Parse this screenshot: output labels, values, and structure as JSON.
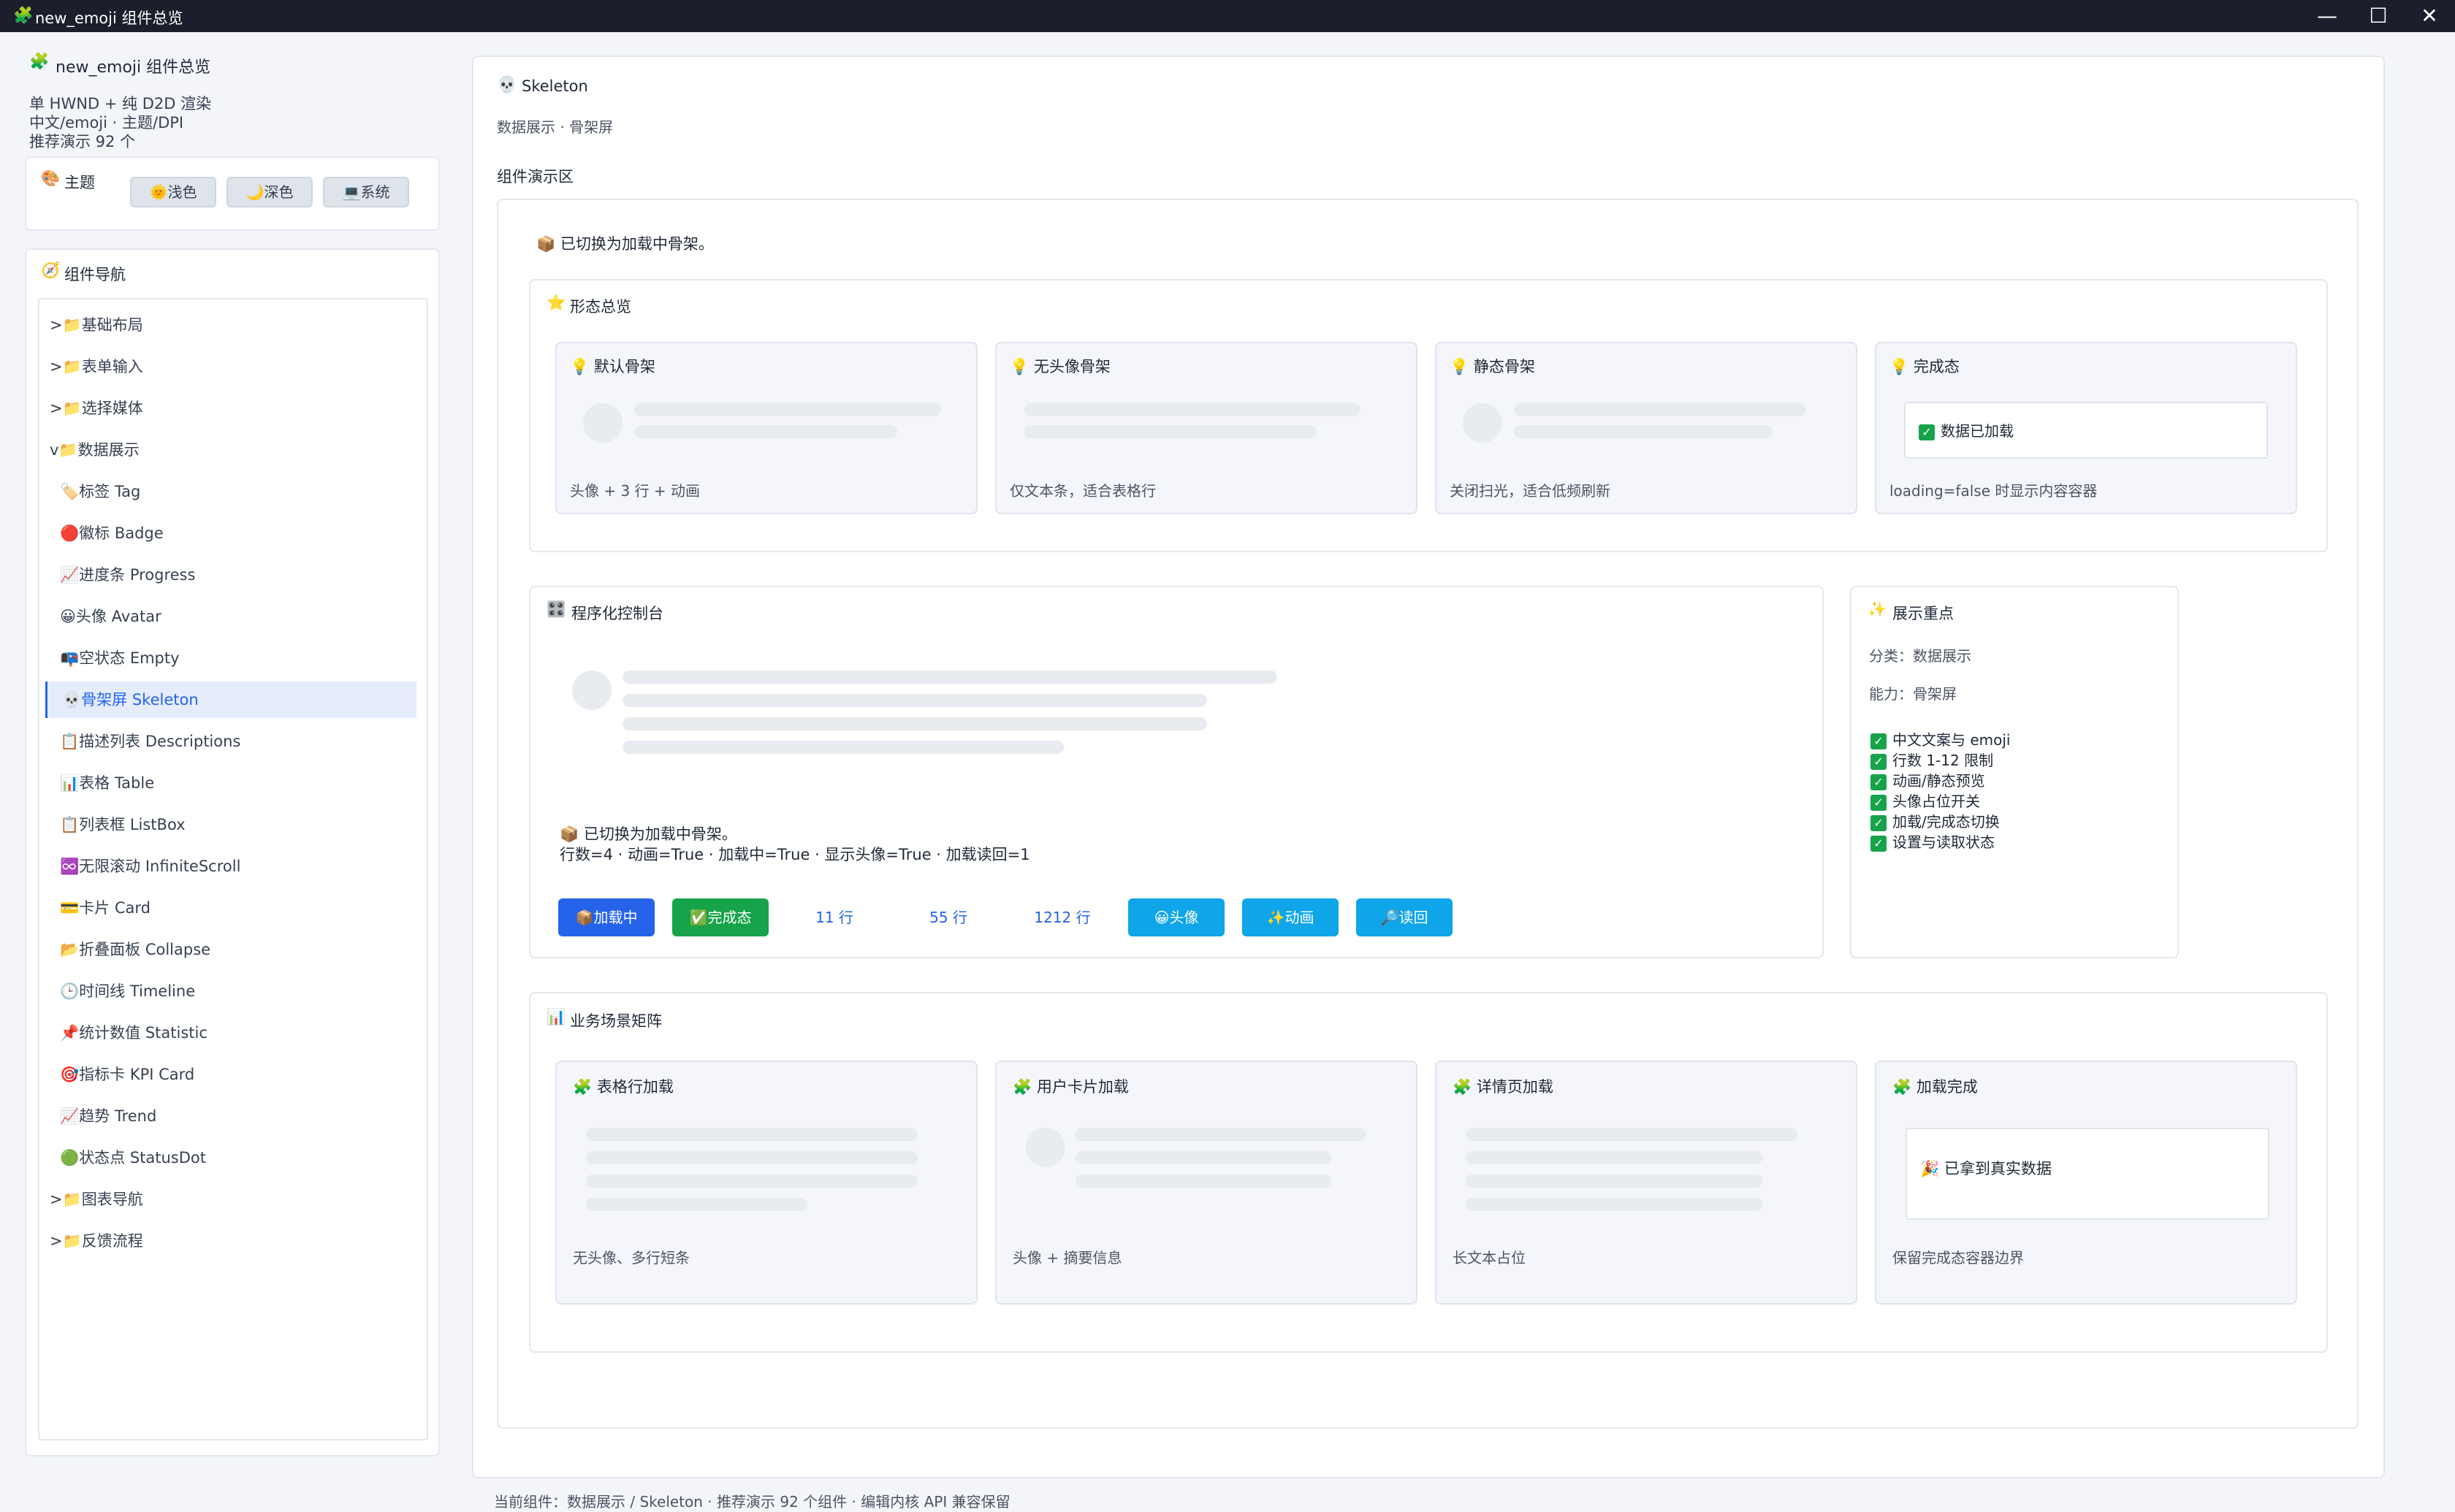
{
  "window": {
    "title": "new_emoji 组件总览",
    "icon": "🧩"
  },
  "sidebar": {
    "app_title": "new_emoji 组件总览",
    "app_icon": "🧩",
    "info_line1": "单 HWND + 纯 D2D 渲染",
    "info_line2": "中文/emoji · 主题/DPI",
    "info_line3": "推荐演示 92 个",
    "theme": {
      "label": "主题",
      "icon": "🎨",
      "buttons": [
        "🌞浅色",
        "🌙深色",
        "💻系统"
      ]
    },
    "nav": {
      "label": "组件导航",
      "icon": "🧭",
      "items": [
        {
          "label": ">📁基础布局"
        },
        {
          "label": ">📁表单输入"
        },
        {
          "label": ">📁选择媒体"
        },
        {
          "label": "v📁数据展示"
        },
        {
          "label": "🏷️标签 Tag"
        },
        {
          "label": "🔴徽标 Badge"
        },
        {
          "label": "📈进度条 Progress"
        },
        {
          "label": "😀头像 Avatar"
        },
        {
          "label": "📭空状态 Empty"
        },
        {
          "label": "💀骨架屏 Skeleton"
        },
        {
          "label": "📋描述列表 Descriptions"
        },
        {
          "label": "📊表格 Table"
        },
        {
          "label": "📋列表框 ListBox"
        },
        {
          "label": "♾️无限滚动 InfiniteScroll"
        },
        {
          "label": "💳卡片 Card"
        },
        {
          "label": "📂折叠面板 Collapse"
        },
        {
          "label": "🕒时间线 Timeline"
        },
        {
          "label": "📌统计数值 Statistic"
        },
        {
          "label": "🎯指标卡 KPI Card"
        },
        {
          "label": "📈趋势 Trend"
        },
        {
          "label": "🟢状态点 StatusDot"
        },
        {
          "label": ">📁图表导航"
        },
        {
          "label": ">📁反馈流程"
        }
      ]
    }
  },
  "main": {
    "title": "Skeleton",
    "title_icon": "💀",
    "breadcrumb": "数据展示 · 骨架屏",
    "demo_label": "组件演示区",
    "status_msg": "📦 已切换为加载中骨架。",
    "overview": {
      "title": "形态总览",
      "icon": "⭐",
      "cards": [
        {
          "title": "💡 默认骨架",
          "caption": "头像 + 3 行 + 动画"
        },
        {
          "title": "💡 无头像骨架",
          "caption": "仅文本条，适合表格行"
        },
        {
          "title": "💡 静态骨架",
          "caption": "关闭扫光，适合低频刷新"
        },
        {
          "title": "💡 完成态",
          "caption": "loading=false 时显示内容容器",
          "content": "数据已加载"
        }
      ]
    },
    "console": {
      "title": "程序化控制台",
      "icon": "🎛️",
      "status_line1": "📦 已切换为加载中骨架。",
      "status_line2": "行数=4 · 动画=True · 加载中=True · 显示头像=True · 加载读回=1",
      "buttons": [
        {
          "label": "📦加载中",
          "color": "#2563eb"
        },
        {
          "label": "✅完成态",
          "color": "#16a34a"
        },
        {
          "label": "11 行"
        },
        {
          "label": "55 行"
        },
        {
          "label": "1212 行"
        },
        {
          "label": "😀头像",
          "color": "#0ea5e9"
        },
        {
          "label": "✨动画",
          "color": "#0ea5e9"
        },
        {
          "label": "🔎读回",
          "color": "#0ea5e9"
        }
      ]
    },
    "highlights": {
      "title": "展示重点",
      "icon": "✨",
      "category": "分类：数据展示",
      "ability": "能力：骨架屏",
      "items": [
        "中文文案与 emoji",
        "行数 1-12 限制",
        "动画/静态预览",
        "头像占位开关",
        "加载/完成态切换",
        "设置与读取状态"
      ]
    },
    "matrix": {
      "title": "业务场景矩阵",
      "icon": "📊",
      "cards": [
        {
          "title": "🧩 表格行加载",
          "caption": "无头像、多行短条"
        },
        {
          "title": "🧩 用户卡片加载",
          "caption": "头像 + 摘要信息"
        },
        {
          "title": "🧩 详情页加载",
          "caption": "长文本占位"
        },
        {
          "title": "🧩 加载完成",
          "caption": "保留完成态容器边界",
          "content": "🎉 已拿到真实数据"
        }
      ]
    },
    "footer": "当前组件：数据展示 / Skeleton · 推荐演示 92 个组件 · 编辑内核 API 兼容保留"
  }
}
